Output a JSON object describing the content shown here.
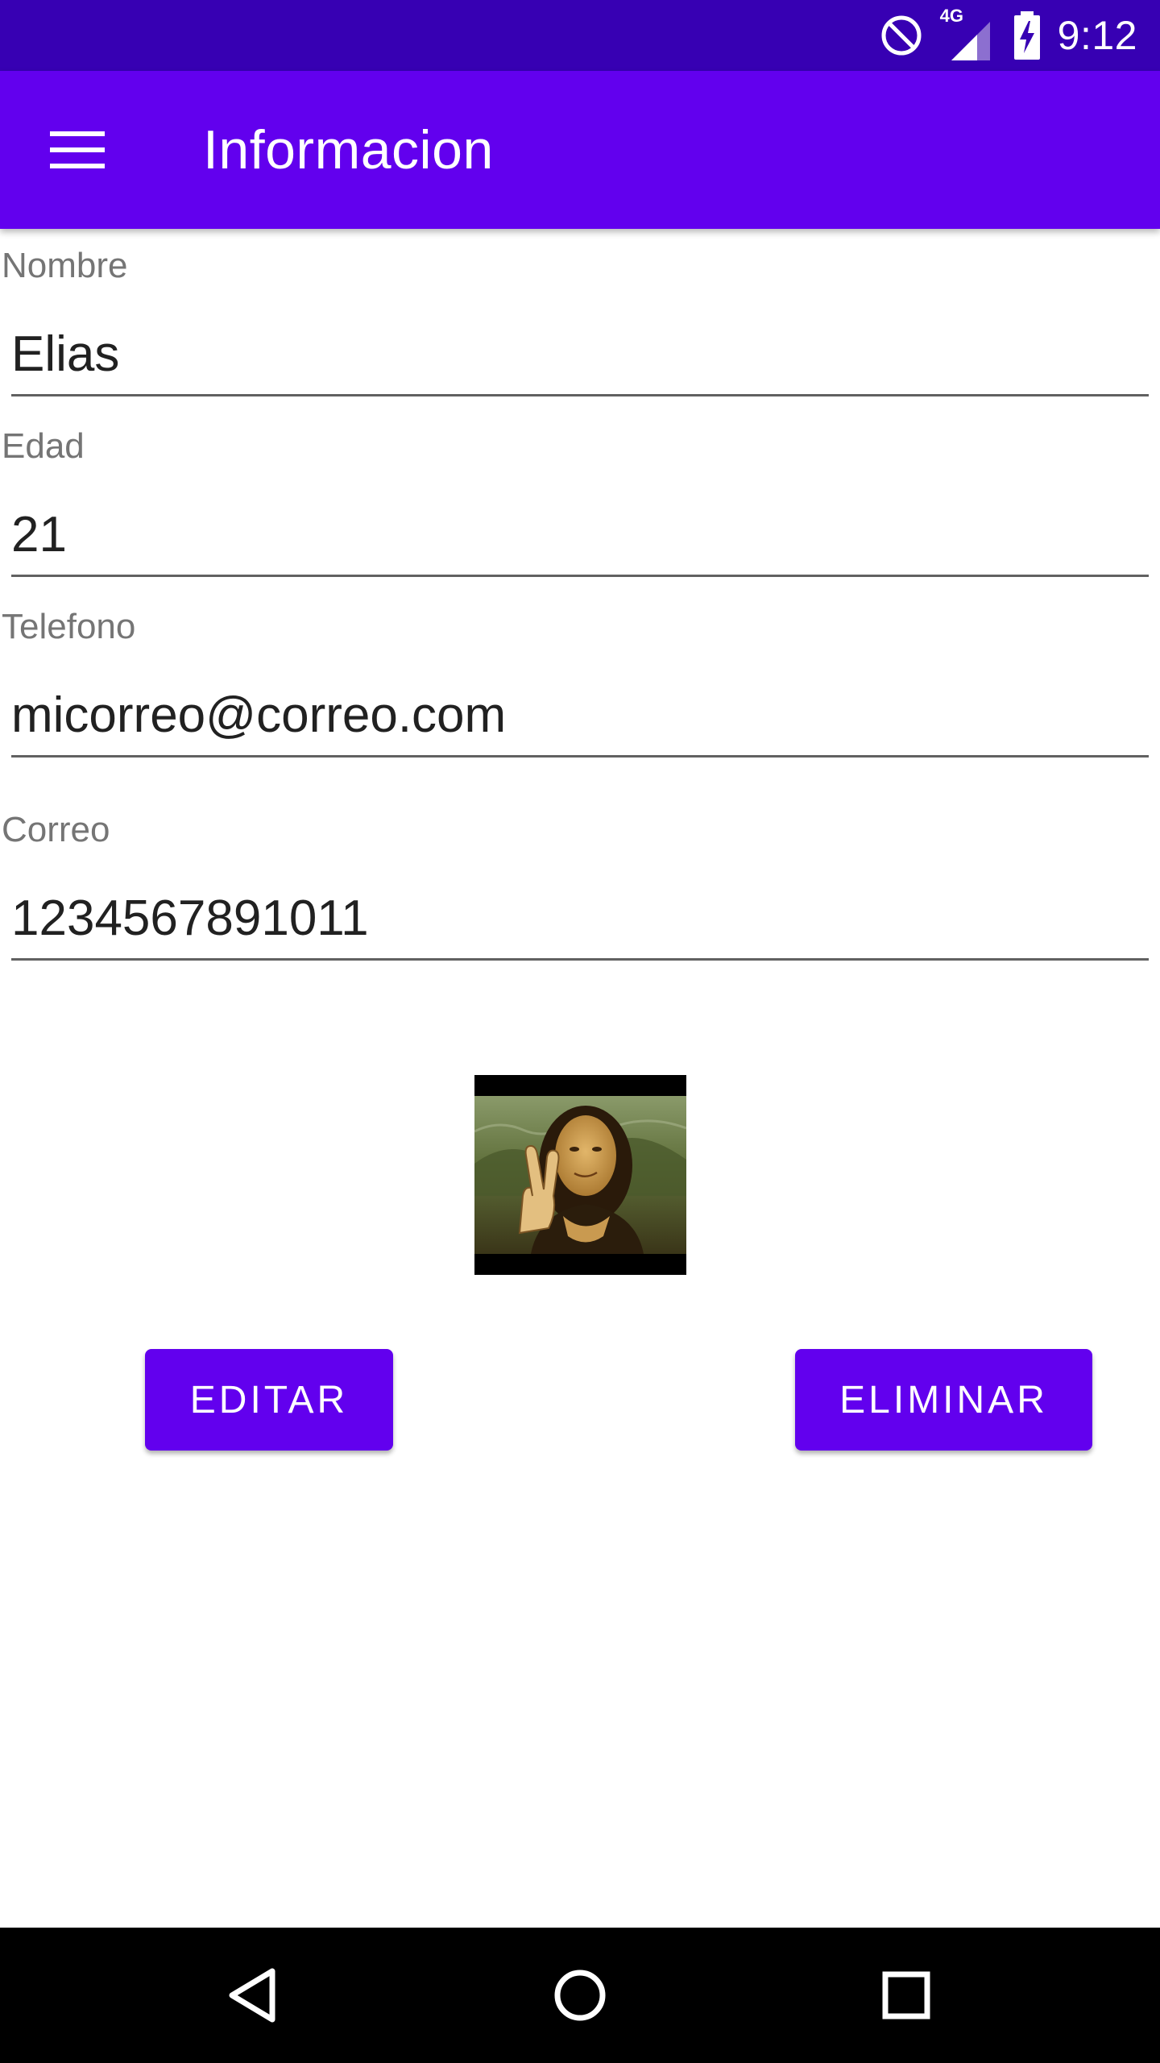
{
  "status_bar": {
    "time": "9:12",
    "network_label": "4G",
    "icons": [
      "do-not-disturb-icon",
      "cellular-signal-icon",
      "battery-charging-icon"
    ]
  },
  "app_bar": {
    "menu_icon": "hamburger-menu-icon",
    "title": "Informacion"
  },
  "form": {
    "fields": [
      {
        "label": "Nombre",
        "value": "Elias"
      },
      {
        "label": "Edad",
        "value": "21"
      },
      {
        "label": "Telefono",
        "value": "micorreo@correo.com"
      },
      {
        "label": "Correo",
        "value": "1234567891011"
      }
    ]
  },
  "photo": {
    "description_icon": "profile-photo"
  },
  "buttons": {
    "edit_label": "EDITAR",
    "delete_label": "ELIMINAR"
  },
  "nav_bar": {
    "icons": [
      "back-icon",
      "home-icon",
      "recents-icon"
    ]
  },
  "colors": {
    "status_bar": "#3700B3",
    "primary": "#6200EE",
    "label_text": "#757575",
    "value_text": "#212121",
    "underline": "#616161"
  }
}
